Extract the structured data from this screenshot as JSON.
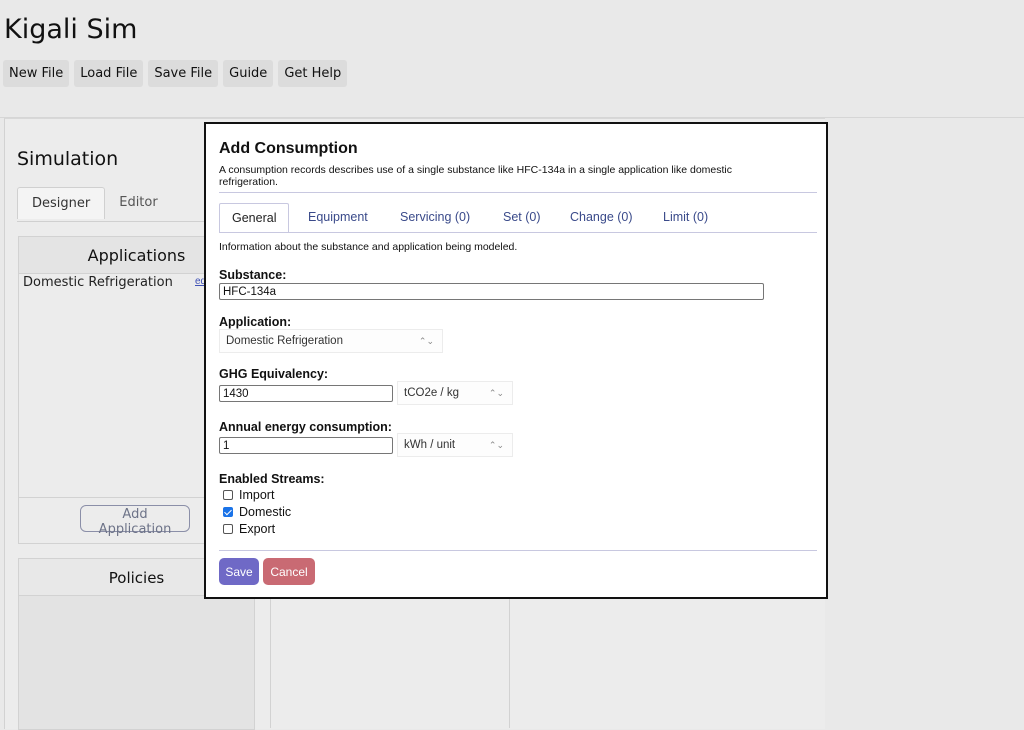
{
  "app": {
    "title": "Kigali Sim",
    "nav": [
      "New File",
      "Load File",
      "Save File",
      "Guide",
      "Get Help"
    ]
  },
  "simulation": {
    "heading": "Simulation",
    "tabs": [
      "Designer",
      "Editor"
    ],
    "applications": {
      "title": "Applications",
      "items": [
        {
          "name": "Domestic Refrigeration",
          "action": "ed"
        }
      ],
      "add_button": "Add Application"
    },
    "policies": {
      "title": "Policies"
    }
  },
  "modal": {
    "title": "Add Consumption",
    "description": "A consumption records describes use of a single substance like HFC-134a in a single application like domestic refrigeration.",
    "tabs": [
      "General",
      "Equipment",
      "Servicing (0)",
      "Set (0)",
      "Change (0)",
      "Limit (0)"
    ],
    "active_tab": "General",
    "tab_description": "Information about the substance and application being modeled.",
    "fields": {
      "substance": {
        "label": "Substance:",
        "value": "HFC-134a"
      },
      "application": {
        "label": "Application:",
        "value": "Domestic Refrigeration"
      },
      "ghg": {
        "label": "GHG Equivalency:",
        "value": "1430",
        "unit": "tCO2e / kg"
      },
      "energy": {
        "label": "Annual energy consumption:",
        "value": "1",
        "unit": "kWh / unit"
      }
    },
    "streams": {
      "label": "Enabled Streams:",
      "items": [
        {
          "name": "Import",
          "checked": false
        },
        {
          "name": "Domestic",
          "checked": true
        },
        {
          "name": "Export",
          "checked": false
        }
      ]
    },
    "save_label": "Save",
    "cancel_label": "Cancel"
  },
  "colors": {
    "save": "#6f69c6",
    "cancel": "#c96a73",
    "checkbox_checked": "#1a73e8",
    "tab_text": "#3a4a8a"
  }
}
